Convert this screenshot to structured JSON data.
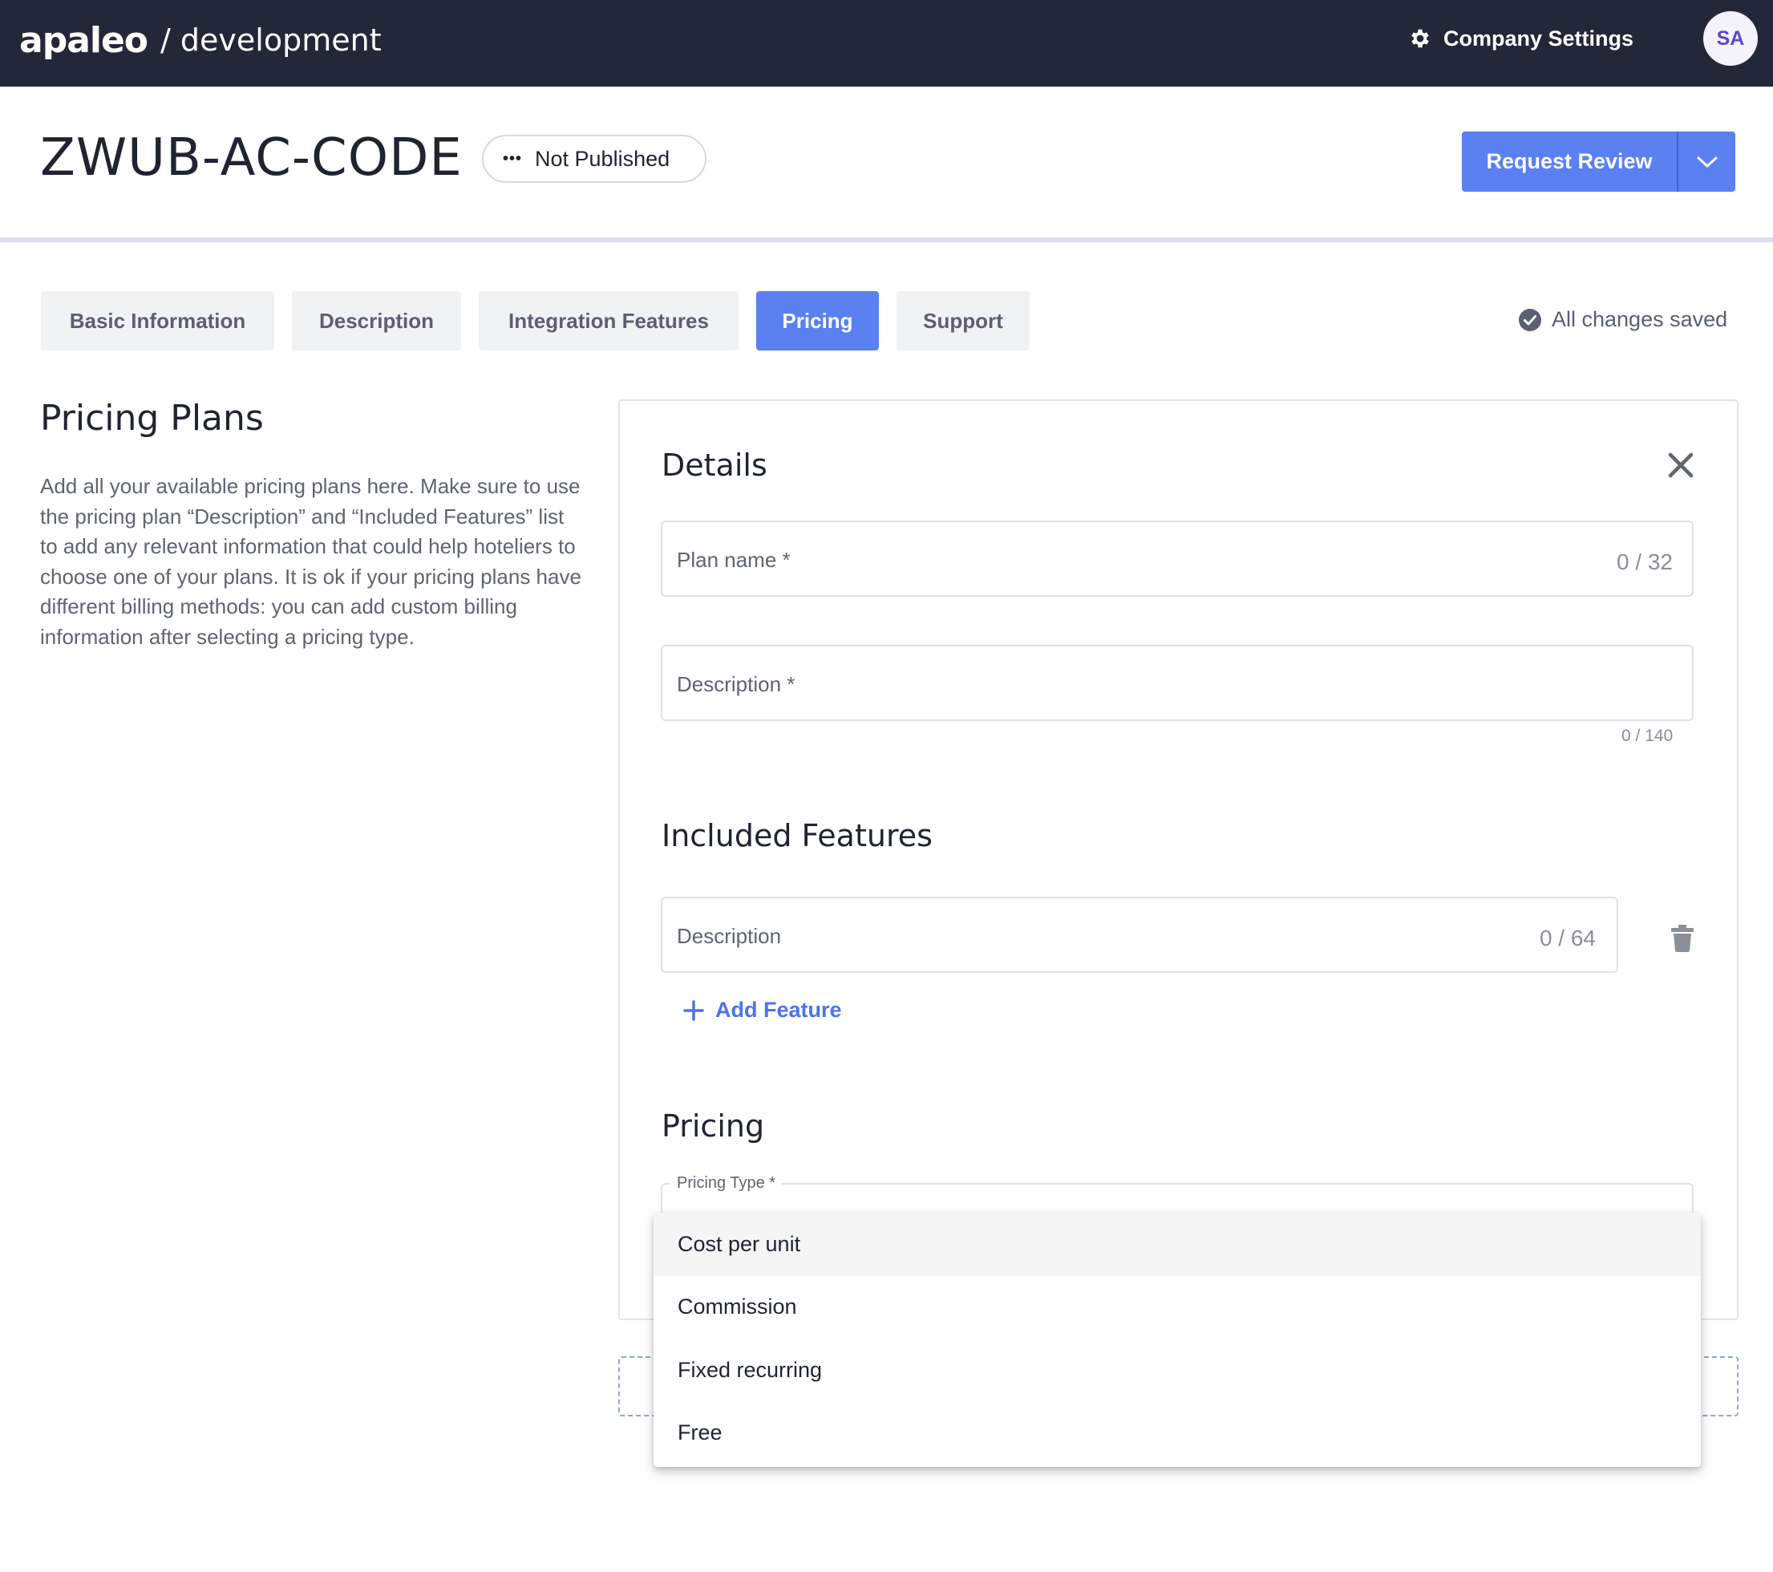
{
  "topbar": {
    "logo": "apaleo",
    "environment": "/ development",
    "company_settings": "Company Settings",
    "avatar_initials": "SA"
  },
  "header": {
    "title": "ZWUB-AC-CODE",
    "status": "Not Published",
    "request_review": "Request Review"
  },
  "tabs": [
    {
      "label": "Basic Information",
      "active": false
    },
    {
      "label": "Description",
      "active": false
    },
    {
      "label": "Integration Features",
      "active": false
    },
    {
      "label": "Pricing",
      "active": true
    },
    {
      "label": "Support",
      "active": false
    }
  ],
  "save_status": "All changes saved",
  "left": {
    "title": "Pricing Plans",
    "description": "Add all your available pricing plans here. Make sure to use the pricing plan “Description” and “Included Features” list to add any relevant information that could help hoteliers to choose one of your plans. It is ok if your pricing plans have different billing methods: you can add custom billing information after selecting a pricing type."
  },
  "details": {
    "heading": "Details",
    "plan_name_label": "Plan name *",
    "plan_name_counter": "0 / 32",
    "description_label": "Description *",
    "description_counter": "0 / 140"
  },
  "features": {
    "heading": "Included Features",
    "description_label": "Description",
    "description_counter": "0 / 64",
    "add_feature": "Add Feature"
  },
  "pricing": {
    "heading": "Pricing",
    "pricing_type_label": "Pricing Type *",
    "options": [
      "Cost per unit",
      "Commission",
      "Fixed recurring",
      "Free"
    ],
    "hovered_option": "Cost per unit"
  },
  "colors": {
    "topbar": "#222838",
    "accent": "#5a80f2",
    "link": "#4d73ea"
  }
}
